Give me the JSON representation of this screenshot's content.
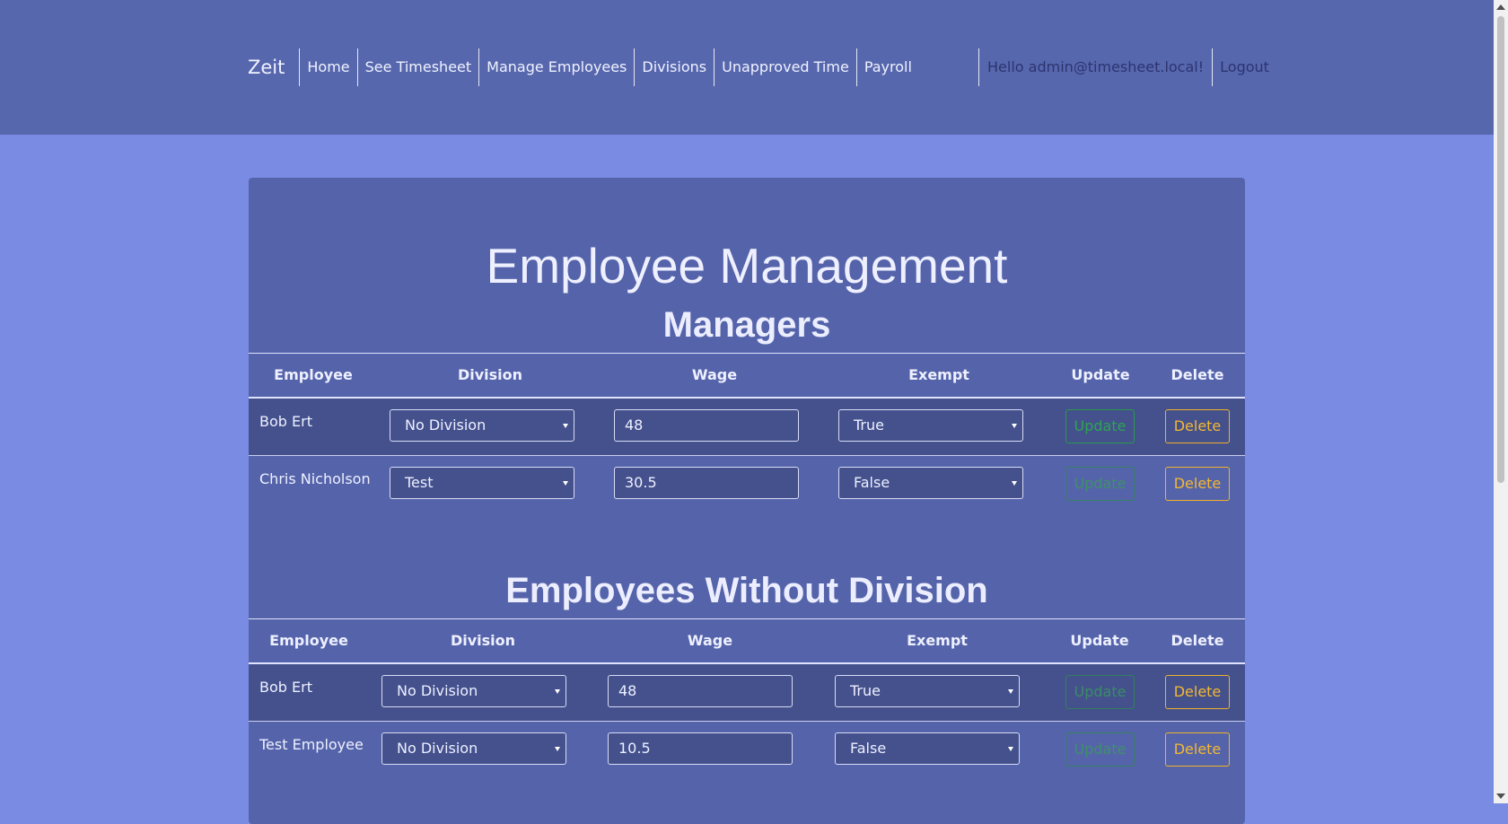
{
  "nav": {
    "brand": "Zeit",
    "links": [
      "Home",
      "See Timesheet",
      "Manage Employees",
      "Divisions",
      "Unapproved Time",
      "Payroll"
    ],
    "hello": "Hello admin@timesheet.local!",
    "logout": "Logout"
  },
  "page": {
    "title": "Employee Management"
  },
  "columns": [
    "Employee",
    "Division",
    "Wage",
    "Exempt",
    "Update",
    "Delete"
  ],
  "sections": [
    {
      "title": "Managers",
      "rows": [
        {
          "name": "Bob Ert",
          "division": "No Division",
          "wage": "48",
          "exempt": "True",
          "update": "Update",
          "delete": "Delete"
        },
        {
          "name": "Chris Nicholson",
          "division": "Test",
          "wage": "30.5",
          "exempt": "False",
          "update": "Update",
          "delete": "Delete"
        }
      ]
    },
    {
      "title": "Employees Without Division",
      "rows": [
        {
          "name": "Bob Ert",
          "division": "No Division",
          "wage": "48",
          "exempt": "True",
          "update": "Update",
          "delete": "Delete"
        },
        {
          "name": "Test Employee",
          "division": "No Division",
          "wage": "10.5",
          "exempt": "False",
          "update": "Update",
          "delete": "Delete"
        }
      ]
    }
  ],
  "colors": {
    "header_bg": "#5767ad",
    "page_bg": "#7a8be3",
    "card_bg": "#5564aa",
    "row_dark": "#44518d",
    "update_green": "#2ea44f",
    "delete_yellow": "#f5b731"
  }
}
